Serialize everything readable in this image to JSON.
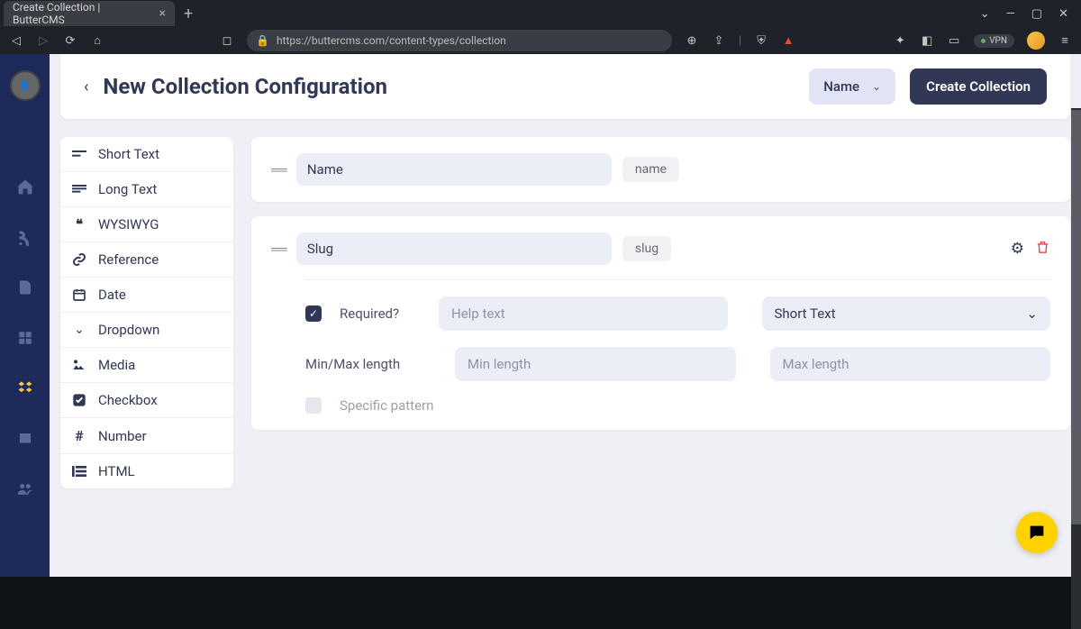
{
  "browser": {
    "tab_title": "Create Collection | ButterCMS",
    "url": "https://buttercms.com/content-types/collection",
    "vpn_label": "VPN"
  },
  "header": {
    "title": "New Collection Configuration",
    "dropdown": "Name",
    "primary": "Create Collection"
  },
  "fieldtypes": [
    {
      "label": "Short Text",
      "icon": "short"
    },
    {
      "label": "Long Text",
      "icon": "long"
    },
    {
      "label": "WYSIWYG",
      "icon": "quote"
    },
    {
      "label": "Reference",
      "icon": "link"
    },
    {
      "label": "Date",
      "icon": "cal"
    },
    {
      "label": "Dropdown",
      "icon": "chev"
    },
    {
      "label": "Media",
      "icon": "media"
    },
    {
      "label": "Checkbox",
      "icon": "check"
    },
    {
      "label": "Number",
      "icon": "hash"
    },
    {
      "label": "HTML",
      "icon": "html"
    }
  ],
  "fields": [
    {
      "name": "Name",
      "slug": "name",
      "expanded": false
    },
    {
      "name": "Slug",
      "slug": "slug",
      "expanded": true
    }
  ],
  "options": {
    "required_label": "Required?",
    "required_checked": true,
    "help_placeholder": "Help text",
    "type_selected": "Short Text",
    "len_label": "Min/Max length",
    "min_placeholder": "Min length",
    "max_placeholder": "Max length",
    "pattern_label": "Specific pattern",
    "pattern_checked": false
  }
}
